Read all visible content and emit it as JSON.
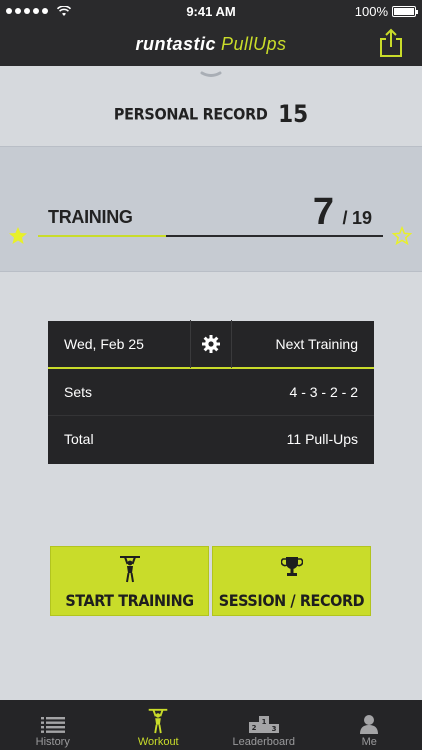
{
  "status_bar": {
    "time": "9:41 AM",
    "battery": "100%"
  },
  "nav": {
    "brand": "runtastic",
    "product": "PullUps",
    "share_icon": "share-icon"
  },
  "record": {
    "label": "PERSONAL RECORD",
    "value": "15"
  },
  "training": {
    "label": "TRAINING",
    "current": "7",
    "separator": "/",
    "total": "19",
    "progress": 0.37
  },
  "info": {
    "date": "Wed, Feb 25",
    "next_label": "Next Training",
    "rows": [
      {
        "label": "Sets",
        "value": "4 - 3 - 2 - 2"
      },
      {
        "label": "Total",
        "value": "11 Pull-Ups"
      }
    ]
  },
  "actions": {
    "start_label": "START TRAINING",
    "session_label": "SESSION / RECORD"
  },
  "tabs": [
    {
      "label": "History",
      "icon": "list-icon",
      "active": false
    },
    {
      "label": "Workout",
      "icon": "pullup-figure-icon",
      "active": true
    },
    {
      "label": "Leaderboard",
      "icon": "podium-icon",
      "active": false
    },
    {
      "label": "Me",
      "icon": "person-icon",
      "active": false
    }
  ],
  "colors": {
    "accent": "#c9dc2a",
    "dark": "#252527",
    "background": "#d6d9dd"
  }
}
